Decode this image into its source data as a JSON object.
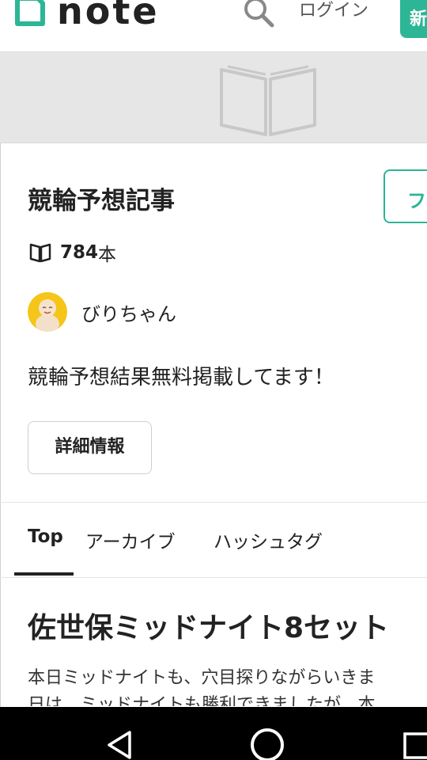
{
  "header": {
    "logo_text": "note",
    "login_label": "ログイン",
    "register_label": "新",
    "icons": {
      "logo": "note-logo-icon",
      "search": "search-icon"
    }
  },
  "banner": {
    "icon": "open-book-icon"
  },
  "magazine": {
    "title": "競輪予想記事",
    "follow_label": "フ",
    "article_count": "784",
    "article_count_unit": "本",
    "author_name": "びりちゃん",
    "description": "競輪予想結果無料掲載してます！",
    "detail_button": "詳細情報"
  },
  "tabs": [
    {
      "label": "Top",
      "active": true
    },
    {
      "label": "アーカイブ",
      "active": false
    },
    {
      "label": "ハッシュタグ",
      "active": false
    }
  ],
  "article": {
    "title": "佐世保ミッドナイト8セット",
    "body_lines": [
      "本日ミッドナイトも、穴目探りながらいきま",
      "日は、ミッドナイトも勝利できましたが、本"
    ]
  },
  "colors": {
    "brand": "#2cb696",
    "text": "#222222",
    "banner_bg": "#e6e6e6"
  },
  "navbar": {
    "icons": [
      "back-icon",
      "home-icon",
      "recent-apps-icon"
    ]
  }
}
